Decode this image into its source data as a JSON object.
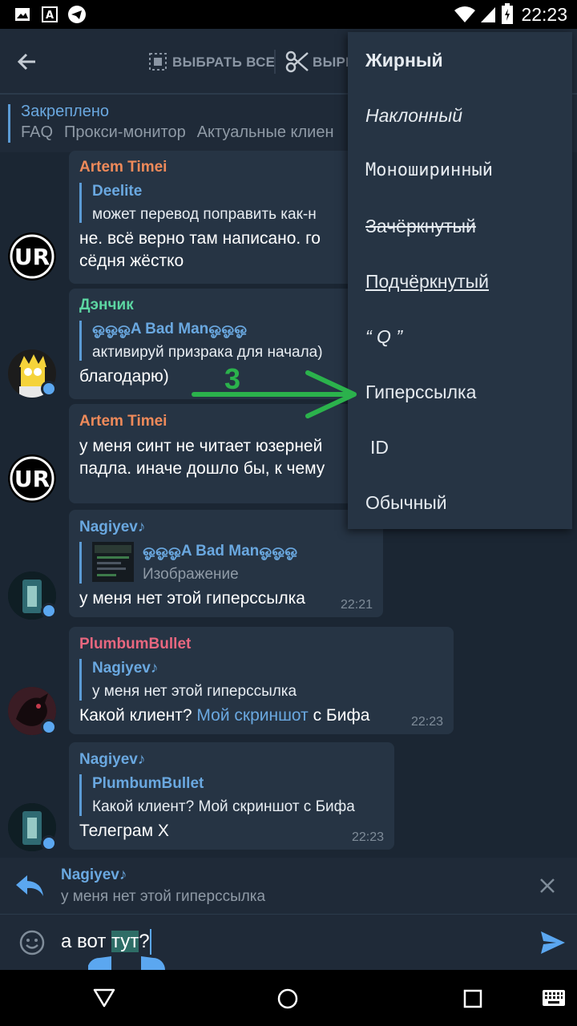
{
  "status_bar": {
    "time": "22:23"
  },
  "toolbar": {
    "select_all_label": "ВЫБРАТЬ ВСЕ",
    "cut_label": "ВЫРЕ"
  },
  "pinned": {
    "title": "Закреплено",
    "items": [
      "FAQ",
      "Прокси-монитор",
      "Актуальные клиен"
    ]
  },
  "messages": [
    {
      "author": "Artem Timei",
      "author_color": "#ef8a5a",
      "quote_author": "Deelite",
      "quote_text": "может перевод поправить как-н",
      "lines": [
        "не. всё верно там написано. го",
        "сёдня жёстко"
      ]
    },
    {
      "author": "Дэнчик",
      "author_color": "#5cd6a2",
      "quote_author": "ஓஓஓA Bad Manஓஓஓ",
      "quote_text": "активируй призрака для начала)",
      "lines": [
        "благодарю)"
      ]
    },
    {
      "author": "Artem Timei",
      "author_color": "#ef8a5a",
      "lines": [
        "у меня синт не читает юзерней",
        "падла. иначе дошло бы, к чему"
      ]
    },
    {
      "author": "Nagiyev♪",
      "author_color": "#6aa8e0",
      "quote_author": "ஓஓஓA Bad Manஓஓஓ",
      "quote_text": "Изображение",
      "lines": [
        "у меня нет этой гиперссылка"
      ],
      "time": "22:21"
    },
    {
      "author": "PlumbumBullet",
      "author_color": "#e8677f",
      "quote_author": "Nagiyev♪",
      "quote_text": "у меня нет этой гиперссылка",
      "line_before_link": "Какой клиент? ",
      "link_text": "Мой скриншот",
      "line_after_link": " с Бифа",
      "time": "22:23"
    },
    {
      "author": "Nagiyev♪",
      "author_color": "#6aa8e0",
      "quote_author": "PlumbumBullet",
      "quote_text": "Какой клиент? Мой скриншот с Бифа",
      "lines": [
        "Телеграм X"
      ],
      "time": "22:23"
    }
  ],
  "format_menu": {
    "items": [
      "Жирный",
      "Наклонный",
      "Моноширинный",
      "Зачёркнутый",
      "Подчёркнутый",
      "“ Q ”",
      "Гиперссылка",
      "ID",
      "Обычный"
    ]
  },
  "annotation": {
    "number": "3",
    "color": "#2bb24c"
  },
  "reply_bar": {
    "author": "Nagiyev♪",
    "text": "у меня нет этой гиперссылка"
  },
  "input": {
    "text_before": "а вот ",
    "selected_text": "тут",
    "text_after": "?"
  },
  "colors": {
    "accent": "#5b9bd5",
    "background": "#1b2633",
    "bubble": "#263444",
    "send": "#5ba7f0"
  }
}
